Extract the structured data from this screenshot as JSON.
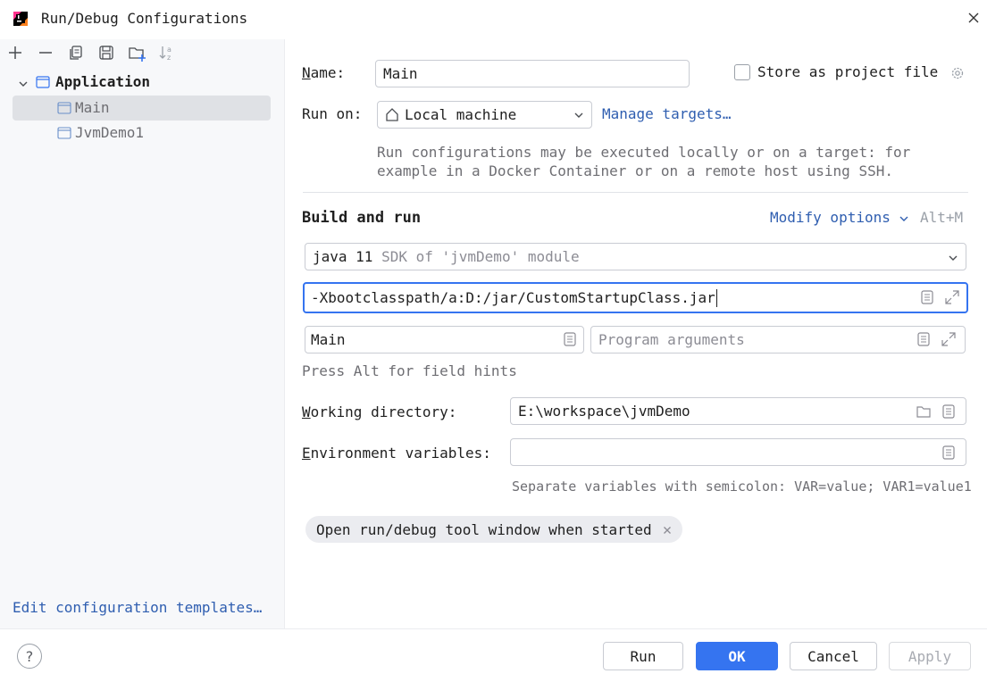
{
  "window": {
    "title": "Run/Debug Configurations"
  },
  "sidebar": {
    "tree": {
      "group_label": "Application",
      "items": [
        {
          "label": "Main",
          "selected": true
        },
        {
          "label": "JvmDemo1",
          "selected": false
        }
      ]
    },
    "edit_templates_link": "Edit configuration templates…"
  },
  "form": {
    "name_label_first": "N",
    "name_label_rest": "ame:",
    "name_value": "Main",
    "store_as_project_file": "Store as project file",
    "run_on_label": "Run on:",
    "run_on_value": "Local machine",
    "manage_targets": "Manage targets…",
    "run_on_hint_line1": "Run configurations may be executed locally or on a target: for",
    "run_on_hint_line2": "example in a Docker Container or on a remote host using SSH.",
    "build_and_run_title": "Build and run",
    "modify_options": "Modify options",
    "modify_options_shortcut": "Alt+M",
    "sdk_value": "java 11",
    "sdk_detail": "SDK of 'jvmDemo' module",
    "vm_options_value": "-Xbootclasspath/a:D:/jar/CustomStartupClass.jar",
    "main_class_value": "Main",
    "program_args_placeholder": "Program arguments",
    "field_hints": "Press Alt for field hints",
    "working_dir_label_first": "W",
    "working_dir_label_rest": "orking directory:",
    "working_dir_value": "E:\\workspace\\jvmDemo",
    "env_vars_label_first": "E",
    "env_vars_label_rest": "nvironment variables:",
    "env_vars_value": "",
    "env_vars_hint": "Separate variables with semicolon: VAR=value; VAR1=value1",
    "chip_label": "Open run/debug tool window when started"
  },
  "buttons": {
    "help": "?",
    "run": "Run",
    "ok": "OK",
    "cancel": "Cancel",
    "apply": "Apply"
  },
  "colors": {
    "accent": "#3574f0",
    "link": "#2f5eb0",
    "sidebar_bg": "#f7f8fa",
    "selection_bg": "#dfe1e5"
  }
}
